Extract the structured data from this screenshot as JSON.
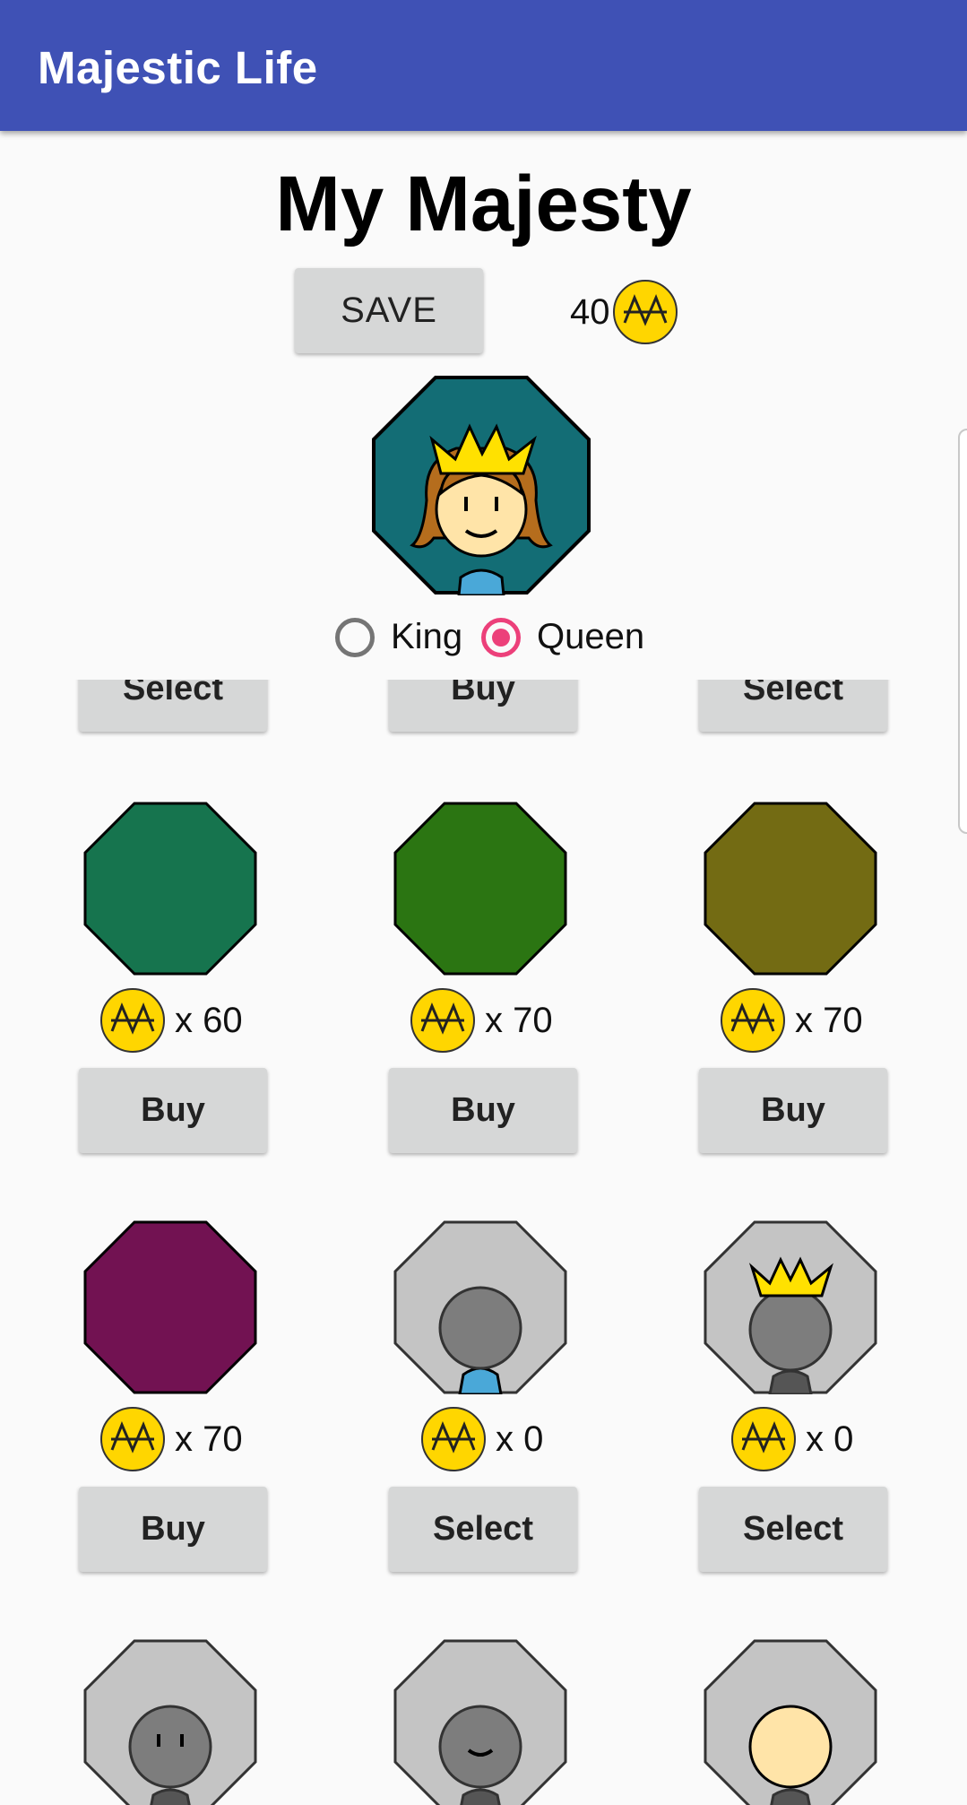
{
  "app_bar": {
    "title": "Majestic Life"
  },
  "page": {
    "title": "My Majesty"
  },
  "toolbar": {
    "save_label": "SAVE",
    "coins": "40"
  },
  "gender": {
    "options": [
      "King",
      "Queen"
    ],
    "selected": "Queen"
  },
  "colors": {
    "app_bar": "#3f51b5",
    "accent": "#ec407a",
    "coin": "#ffd600",
    "button": "#d6d7d7",
    "avatar_bg": "#136d75"
  },
  "shop": {
    "row0": [
      "Select",
      "Buy",
      "Select"
    ],
    "row1": [
      {
        "color": "#16744e",
        "price": "x 60",
        "action": "Buy"
      },
      {
        "color": "#2b7512",
        "price": "x 70",
        "action": "Buy"
      },
      {
        "color": "#736b13",
        "price": "x 70",
        "action": "Buy"
      }
    ],
    "row2": [
      {
        "item": "purple-background",
        "color": "#721252",
        "price": "x 70",
        "action": "Buy"
      },
      {
        "item": "blue-shirt",
        "price": "x 0",
        "action": "Select"
      },
      {
        "item": "crown",
        "price": "x 0",
        "action": "Select"
      }
    ],
    "row3": [
      {
        "item": "eyes"
      },
      {
        "item": "smile"
      },
      {
        "item": "skin-tone"
      }
    ]
  }
}
